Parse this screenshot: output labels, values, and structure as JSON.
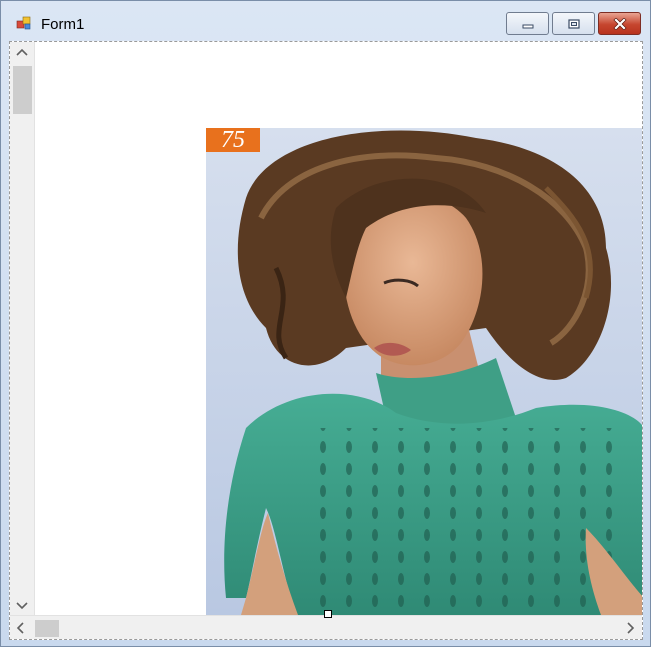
{
  "window": {
    "title": "Form1",
    "minimize_label": "",
    "maximize_label": "",
    "close_label": ""
  },
  "picture": {
    "badge_text": "75"
  },
  "colors": {
    "client_bg": "#ffffff",
    "badge": "#e8711d",
    "sweater": "#3d9e88",
    "photo_bg": "#c9d6ea"
  }
}
